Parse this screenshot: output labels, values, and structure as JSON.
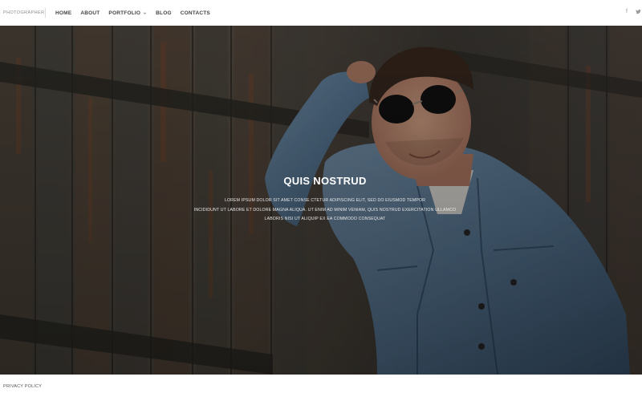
{
  "header": {
    "logo": "PHOTOGRAPHER",
    "nav": [
      {
        "label": "HOME"
      },
      {
        "label": "ABOUT"
      },
      {
        "label": "PORTFOLIO"
      },
      {
        "label": "BLOG"
      },
      {
        "label": "CONTACTS"
      }
    ],
    "social": {
      "facebook": "f",
      "twitter": "t"
    }
  },
  "hero": {
    "title": "QUIS NOSTRUD",
    "text_lines": [
      "LOREM IPSUM DOLOR SIT AMET CONSE CTETUR ADIPISCING ELIT, SED DO EIUSMOD TEMPOR",
      "INCIDIDUNT UT LABORE ET DOLORE MAGNA ALIQUA. UT ENIM AD MINIM VENIAM, QUIS NOSTRUD EXERCITATION ULLAMCO",
      "LABORIS NISI UT ALIQUIP EX EA COMMODO CONSEQUAT"
    ]
  },
  "footer": {
    "privacy_link": "PRIVACY POLICY"
  },
  "colors": {
    "nav_text": "#444444",
    "hero_overlay": "#3d3a35",
    "denim": "#5f7f9c"
  },
  "icons": {
    "portfolio_dropdown": "chevron-down-icon",
    "facebook": "facebook-icon",
    "twitter": "twitter-icon"
  }
}
